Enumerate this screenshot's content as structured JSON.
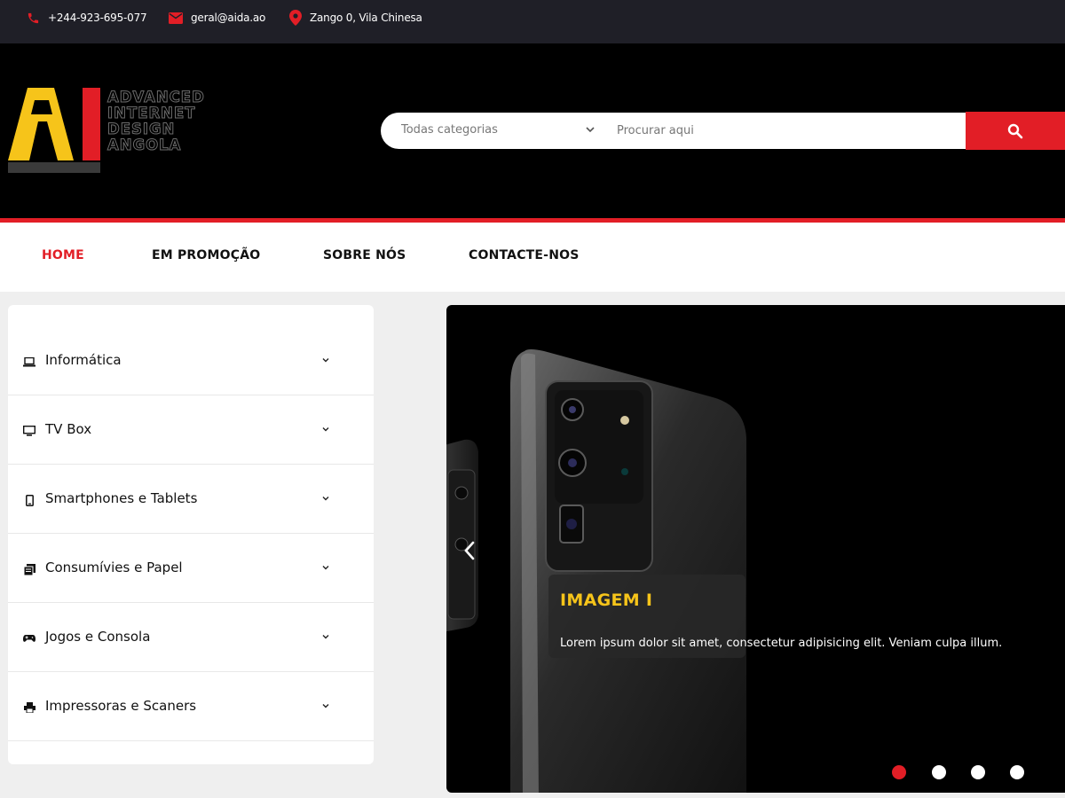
{
  "topbar": {
    "phone": "+244-923-695-077",
    "email": "geral@aida.ao",
    "address": "Zango 0, Vila Chinesa"
  },
  "logo": {
    "letters": "AI",
    "words": [
      "ADVANCED",
      "INTERNET",
      "DESIGN",
      "ANGOLA"
    ]
  },
  "search": {
    "category_label": "Todas categorias",
    "placeholder": "Procurar aqui"
  },
  "nav": {
    "items": [
      "HOME",
      "EM PROMOÇÃO",
      "SOBRE NÓS",
      "CONTACTE-NOS"
    ],
    "active": "HOME"
  },
  "categories": [
    {
      "label": "Informática",
      "icon": "laptop-icon"
    },
    {
      "label": "TV Box",
      "icon": "tv-icon"
    },
    {
      "label": "Smartphones e Tablets",
      "icon": "smartphone-icon"
    },
    {
      "label": "Consumívies e Papel",
      "icon": "paper-icon"
    },
    {
      "label": "Jogos e Consola",
      "icon": "gamepad-icon"
    },
    {
      "label": "Impressoras e Scaners",
      "icon": "printer-icon"
    }
  ],
  "slider": {
    "caption_title": "IMAGEM I",
    "caption_text": "Lorem ipsum dolor sit amet, consectetur adipisicing elit. Veniam culpa illum.",
    "slide_count": 4,
    "active_slide": 1
  },
  "colors": {
    "accent_red": "#e21e26",
    "logo_yellow": "#f6c41a",
    "topbar_bg": "#1f1f27"
  }
}
